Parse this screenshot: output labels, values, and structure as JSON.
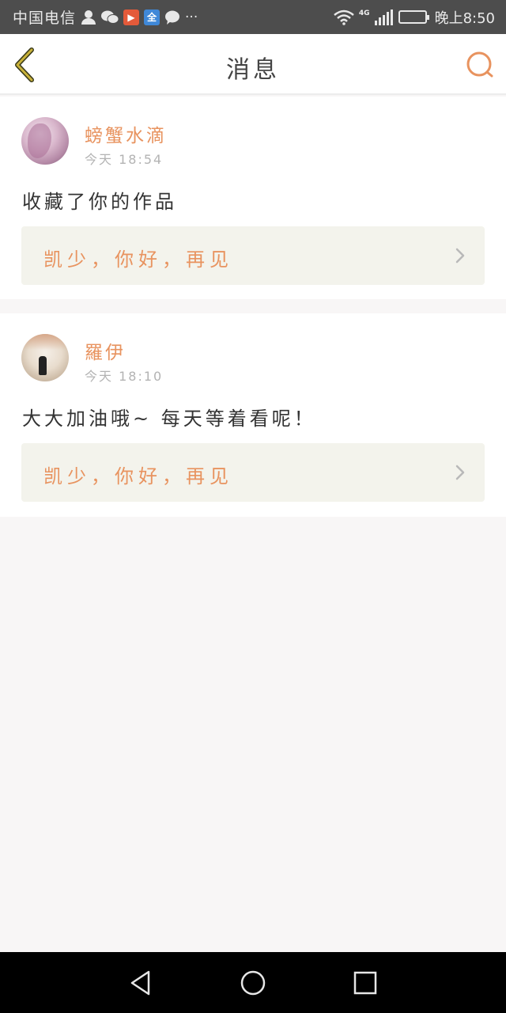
{
  "status_bar": {
    "carrier": "中国电信",
    "app_badge_red": "▶",
    "app_badge_blue": "全",
    "more": "···",
    "network": "4G",
    "time": "晚上8:50"
  },
  "header": {
    "title": "消息"
  },
  "messages": [
    {
      "user_name": "螃蟹水滴",
      "time": "今天 18:54",
      "text": "收藏了你的作品",
      "work_title": "凯少，你好，再见"
    },
    {
      "user_name": "羅伊",
      "time": "今天 18:10",
      "text": "大大加油哦~ 每天等着看呢！",
      "work_title": "凯少，你好，再见"
    }
  ],
  "colors": {
    "accent": "#e8935f",
    "back_arrow": "#c9b23a",
    "status_bar": "#4d4d4d",
    "link_bg": "#f3f3ec"
  }
}
